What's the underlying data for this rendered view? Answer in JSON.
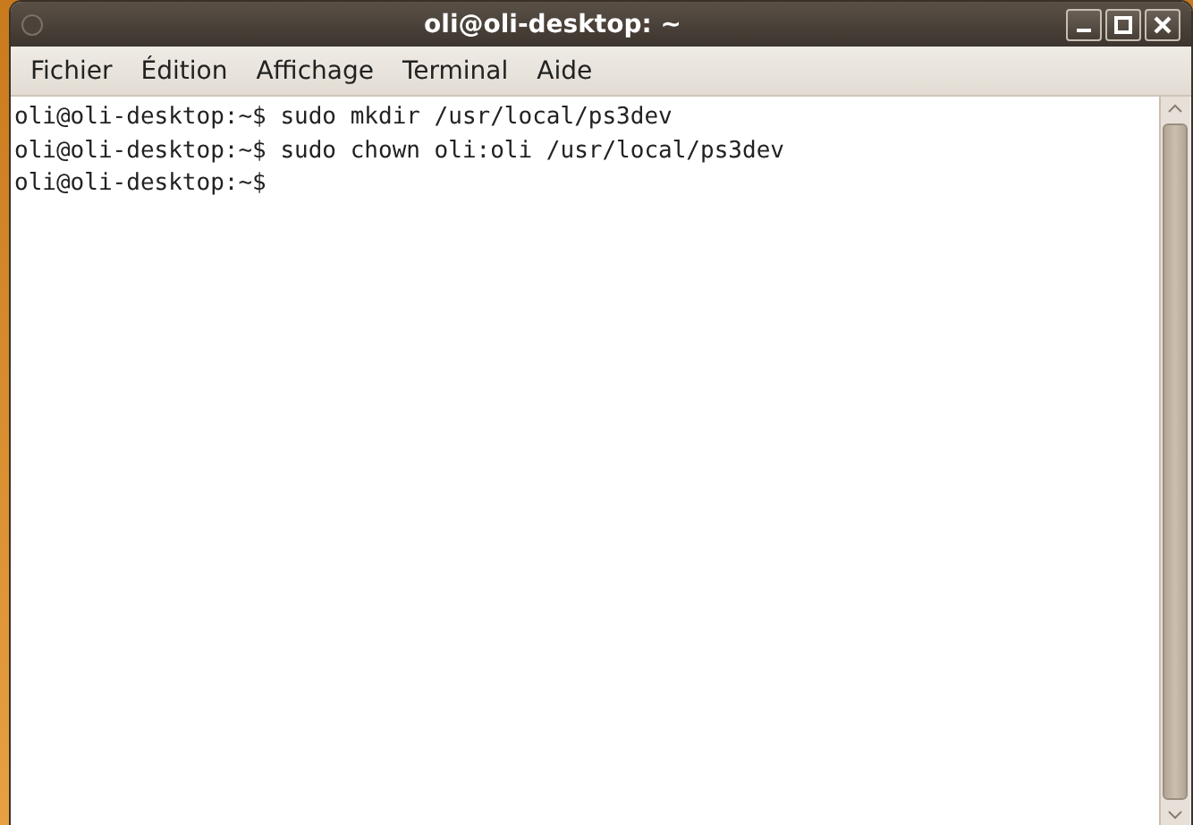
{
  "window": {
    "title": "oli@oli-desktop: ~"
  },
  "menu": [
    {
      "label": "Fichier"
    },
    {
      "label": "Édition"
    },
    {
      "label": "Affichage"
    },
    {
      "label": "Terminal"
    },
    {
      "label": "Aide"
    }
  ],
  "terminal": {
    "lines": [
      "oli@oli-desktop:~$ sudo mkdir /usr/local/ps3dev",
      "oli@oli-desktop:~$ sudo chown oli:oli /usr/local/ps3dev",
      "oli@oli-desktop:~$"
    ]
  }
}
